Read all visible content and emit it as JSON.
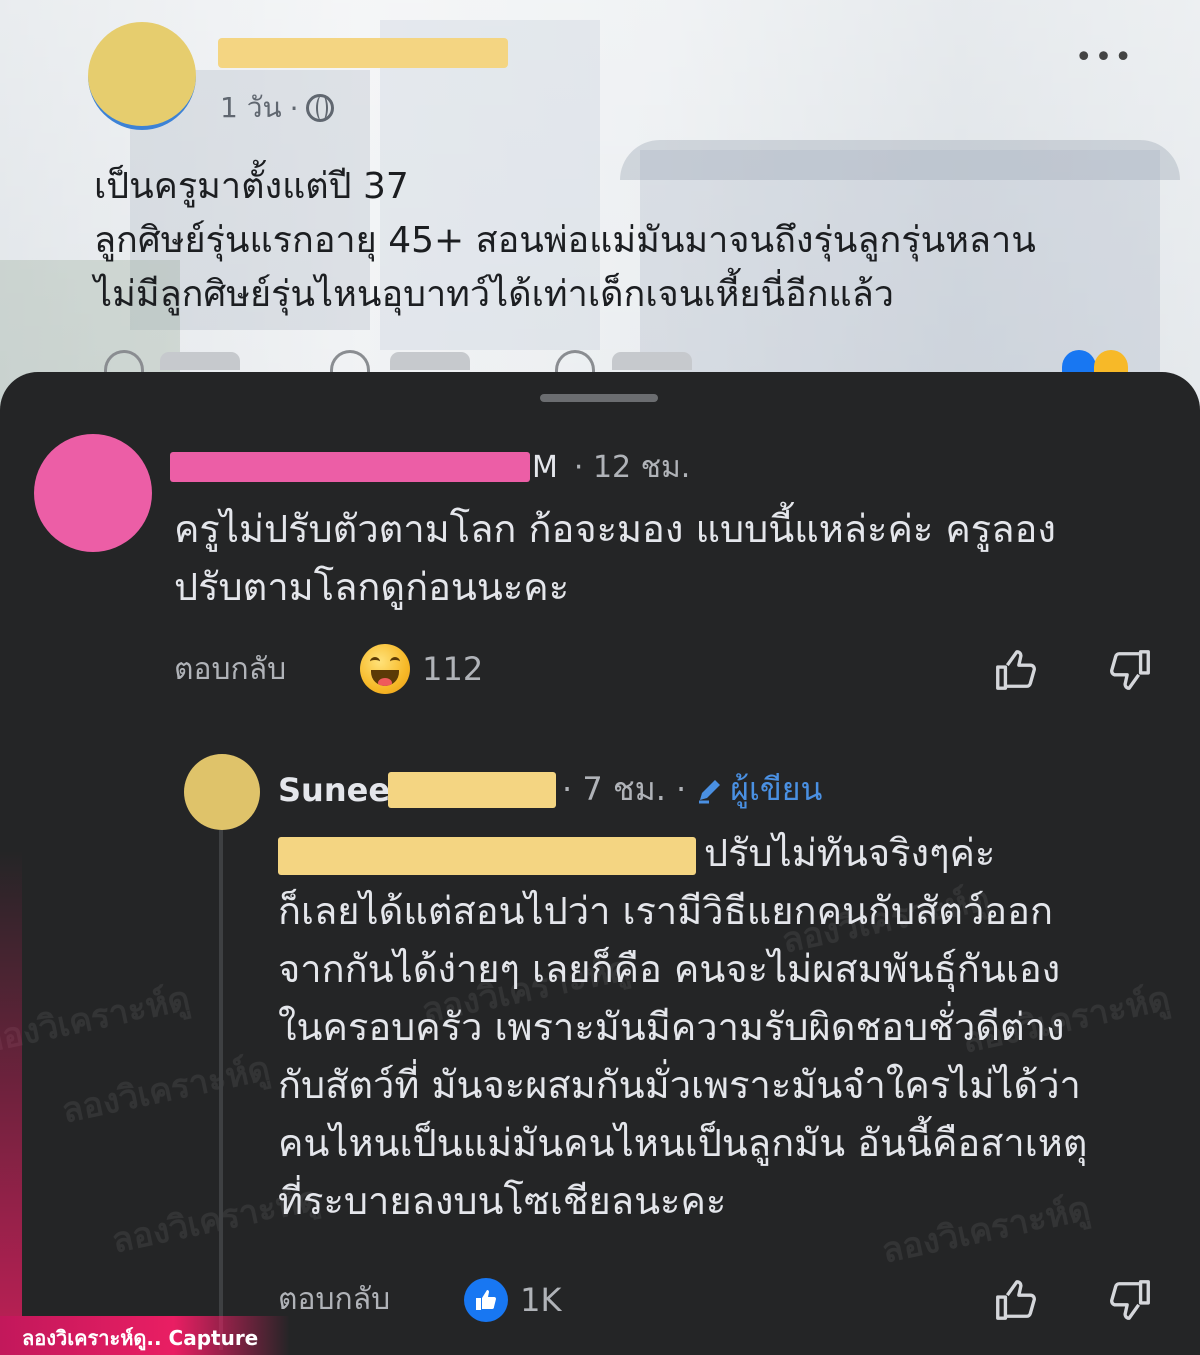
{
  "post": {
    "time": "1 วัน",
    "separator": "·",
    "lines": [
      "เป็นครูมาตั้งแต่ปี 37",
      "ลูกศิษย์รุ่นแรกอายุ 45+ สอนพ่อแม่มันมาจนถึงรุ่นลูกรุ่นหลาน",
      "ไม่มีลูกศิษย์รุ่นไหนอุบาทว์ได้เท่าเด็กเจนเหี้ยนี่อีกแล้ว"
    ],
    "more_icon": "•••"
  },
  "comment1": {
    "name_tail": "M",
    "time": "· 12 ชม.",
    "lines": [
      "ครูไม่ปรับตัวตามโลก ก้อจะมอง แบบนี้แหล่ะค่ะ ครูลอง",
      "ปรับตามโลกดูก่อนนะคะ"
    ],
    "reply_label": "ตอบกลับ",
    "reaction_icon": "haha-emoji",
    "reaction_count": "112"
  },
  "comment2": {
    "name_visible": "Sunee",
    "time": "· 7 ชม. ·",
    "author_label": "ผู้เขียน",
    "first_line_tail": "ปรับไม่ทันจริงๆค่ะ",
    "lines": [
      "ก็เลยได้แต่สอนไปว่า เรามีวิธีแยกคนกับสัตว์ออก",
      "จากกันได้ง่ายๆ เลยก็คือ คนจะไม่ผสมพันธุ์กันเอง",
      "ในครอบครัว เพราะมันมีความรับผิดชอบชั่วดีต่าง",
      "กับสัตว์ที่ มันจะผสมกันมั่วเพราะมันจำใครไม่ได้ว่า",
      "คนไหนเป็นแม่มันคนไหนเป็นลูกมัน อันนี้คือสาเหตุ",
      "ที่ระบายลงบนโซเชียลนะคะ"
    ],
    "reply_label": "ตอบกลับ",
    "reaction_icon": "like-icon",
    "reaction_count": "1K"
  },
  "watermark": "ลองวิเคราะห์ดู",
  "capture_label": "ลองวิเคราะห์ดู.. Capture",
  "colors": {
    "sheet_bg": "#242526",
    "redact_pink": "#ec5ea6",
    "redact_yellow": "#f4d582",
    "author_blue": "#4a90e2",
    "like_blue": "#1877f2"
  }
}
